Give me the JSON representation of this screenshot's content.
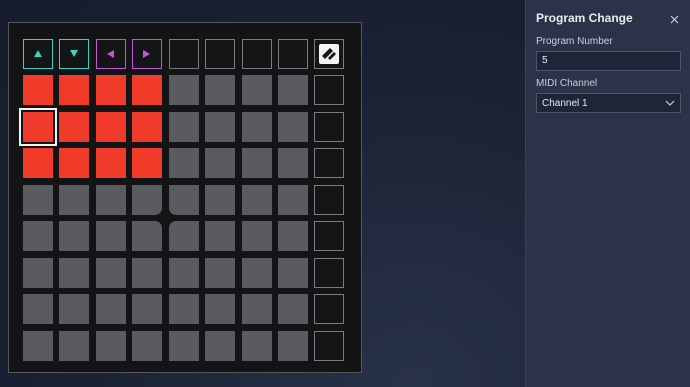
{
  "grid": {
    "top_arrows": [
      {
        "name": "up-arrow-icon",
        "color": "#3fd1c0",
        "dir": "up"
      },
      {
        "name": "down-arrow-icon",
        "color": "#3fd1c0",
        "dir": "down"
      },
      {
        "name": "left-arrow-icon",
        "color": "#c454d8",
        "dir": "left"
      },
      {
        "name": "right-arrow-icon",
        "color": "#c454d8",
        "dir": "right"
      }
    ],
    "rows": 8,
    "cols": 8,
    "active_color": "#f03a2a",
    "inactive_color": "#5a5b5e",
    "active_pads": [
      [
        0,
        0
      ],
      [
        0,
        1
      ],
      [
        0,
        2
      ],
      [
        0,
        3
      ],
      [
        1,
        0
      ],
      [
        1,
        1
      ],
      [
        1,
        2
      ],
      [
        1,
        3
      ],
      [
        2,
        0
      ],
      [
        2,
        1
      ],
      [
        2,
        2
      ],
      [
        2,
        3
      ]
    ],
    "selected_pad": [
      1,
      0
    ],
    "logo_icon": "novation-logo-icon"
  },
  "panel": {
    "title": "Program Change",
    "close_icon": "close-icon",
    "program_number_label": "Program Number",
    "program_number_value": "5",
    "midi_channel_label": "MIDI Channel",
    "midi_channel_value": "Channel 1",
    "dropdown_icon": "chevron-down-icon"
  }
}
